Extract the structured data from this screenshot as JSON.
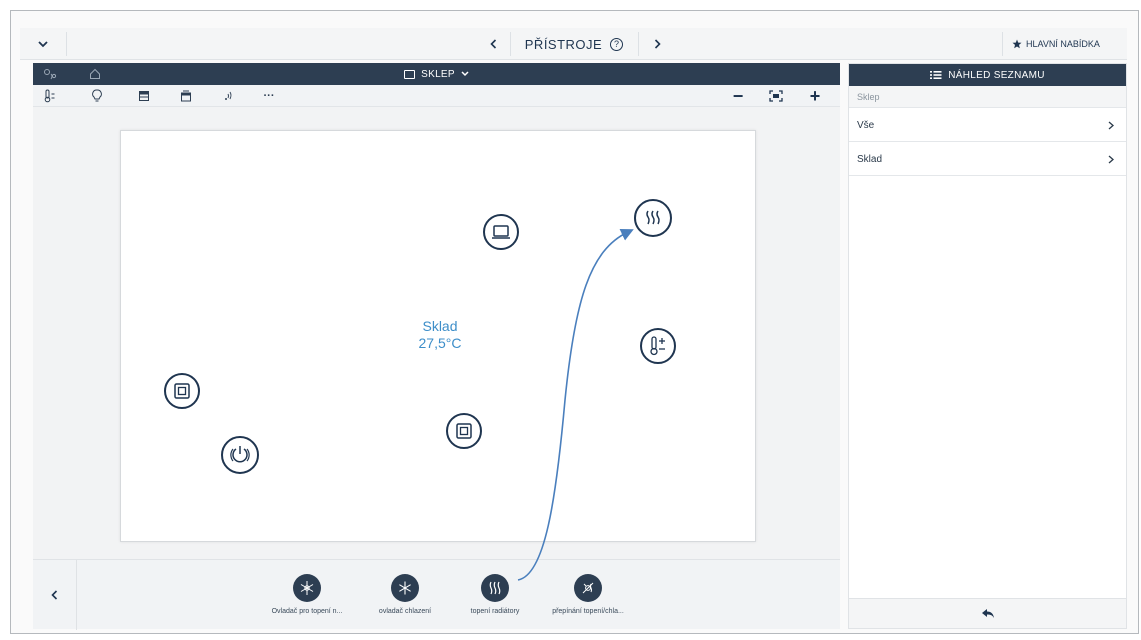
{
  "topbar": {
    "collapse_icon": "chevron-down-icon",
    "prev_icon": "chevron-left-icon",
    "title": "PŘÍSTROJE",
    "help_glyph": "?",
    "next_icon": "chevron-right-icon",
    "main_menu_label": "HLAVNÍ NABÍDKA",
    "main_menu_icon": "star-icon"
  },
  "floorplan_header": {
    "floor_label": "SKLEP",
    "floor_icon": "floorplan-icon",
    "dropdown_icon": "chevron-down-icon",
    "left_icons": [
      "sensor-icon",
      "home-icon"
    ]
  },
  "toolbar": {
    "filters": [
      "thermometer-icon",
      "bulb-icon",
      "blind-icon",
      "shutter-icon",
      "signal-icon",
      "more-icon"
    ],
    "more_glyph": "···",
    "zoom_out": "−",
    "zoom_in": "+",
    "fit_icon": "fit-screen-icon"
  },
  "room": {
    "name": "Sklad",
    "temperature": "27,5°C"
  },
  "devices": [
    {
      "name": "socket-device",
      "icon": "socket-icon"
    },
    {
      "name": "heating-device",
      "icon": "radiator-icon"
    },
    {
      "name": "thermostat-device",
      "icon": "thermometer-plus-minus-icon"
    },
    {
      "name": "switch-device-left",
      "icon": "switch-icon"
    },
    {
      "name": "switch-device-center",
      "icon": "switch-icon"
    },
    {
      "name": "power-device",
      "icon": "power-icon"
    }
  ],
  "favorites": [
    {
      "label": "Ovladač pro topení n...",
      "icon": "heating-cooling-icon"
    },
    {
      "label": "ovladač chlazení",
      "icon": "snowflake-icon"
    },
    {
      "label": "topení radiátory",
      "icon": "radiator-icon"
    },
    {
      "label": "přepínání topení/chla...",
      "icon": "heating-cooling-switch-icon"
    }
  ],
  "right_panel": {
    "header_label": "NÁHLED SEZNAMU",
    "header_icon": "list-icon",
    "breadcrumb": "Sklep",
    "items": [
      {
        "label": "Vše"
      },
      {
        "label": "Sklad"
      }
    ],
    "back_icon": "back-arrow-icon"
  },
  "colors": {
    "header_bg": "#2d3e52",
    "accent_text": "#3d8ec9",
    "icon_stroke": "#1f3550",
    "arrow": "#4a7fbd"
  }
}
